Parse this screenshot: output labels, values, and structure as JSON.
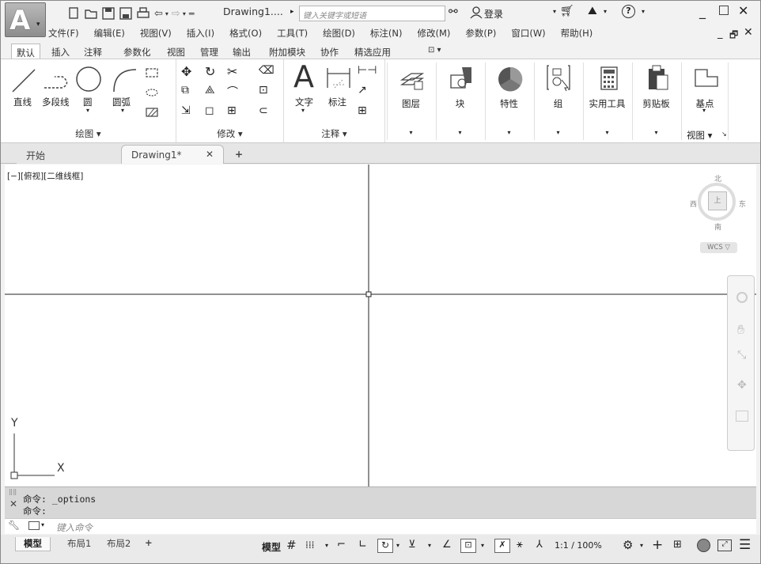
{
  "app": {
    "doc_title": "Drawing1....",
    "search_placeholder": "键入关键字或短语",
    "login": "登录",
    "help": "?"
  },
  "menu": [
    "文件(F)",
    "编辑(E)",
    "视图(V)",
    "插入(I)",
    "格式(O)",
    "工具(T)",
    "绘图(D)",
    "标注(N)",
    "修改(M)",
    "参数(P)",
    "窗口(W)",
    "帮助(H)"
  ],
  "ribbon_tabs": [
    "默认",
    "插入",
    "注释",
    "参数化",
    "视图",
    "管理",
    "输出",
    "附加模块",
    "协作",
    "精选应用"
  ],
  "ribbon": {
    "draw": {
      "label": "绘图 ▾",
      "line": "直线",
      "polyline": "多段线",
      "circle": "圆",
      "arc": "圆弧"
    },
    "modify": {
      "label": "修改 ▾"
    },
    "annotation": {
      "label": "注释 ▾",
      "text": "文字",
      "dim": "标注"
    },
    "tiles": [
      "图层",
      "块",
      "特性",
      "组",
      "实用工具",
      "剪贴板"
    ],
    "view": {
      "base": "基点",
      "label": "视图 ▾"
    }
  },
  "doc_tabs": {
    "start": "开始",
    "drawing": "Drawing1*",
    "close": "✕",
    "plus": "+"
  },
  "viewport": {
    "label": "[−][俯视][二维线框]",
    "north": "北",
    "south": "南",
    "east": "东",
    "west": "西",
    "wcs": "WCS ▽",
    "axis_x": "X",
    "axis_y": "Y"
  },
  "command": {
    "line1": "命令: _options",
    "line2": "命令:",
    "placeholder": "键入命令"
  },
  "layout_tabs": [
    "模型",
    "布局1",
    "布局2",
    "+"
  ],
  "status": {
    "model": "模型",
    "scale": "1:1 / 100%"
  }
}
